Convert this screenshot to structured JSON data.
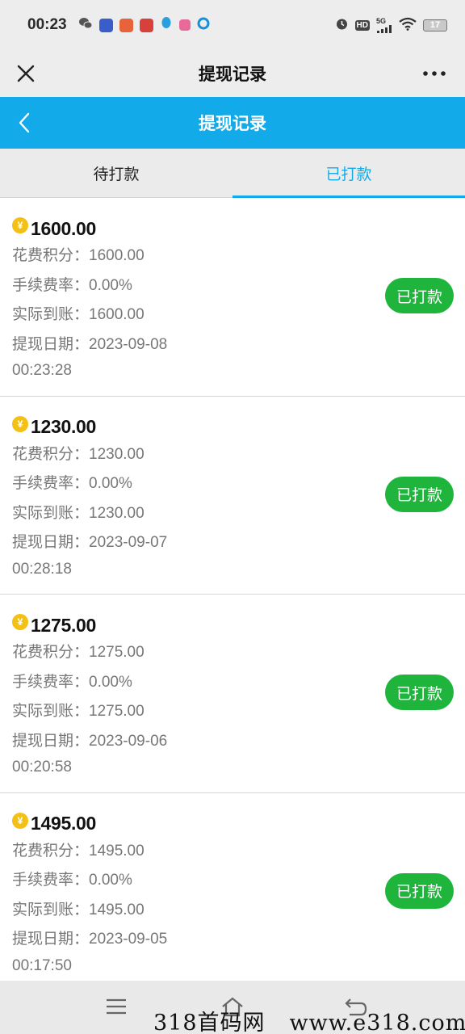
{
  "status_bar": {
    "time": "00:23",
    "network": "5G",
    "hd": "HD",
    "battery": "17"
  },
  "title_bar": {
    "title": "提现记录"
  },
  "app_header": {
    "title": "提现记录"
  },
  "tabs": [
    {
      "label": "待打款",
      "active": false
    },
    {
      "label": "已打款",
      "active": true
    }
  ],
  "labels": {
    "cost": "花费积分：",
    "fee": "手续费率：",
    "actual": "实际到账：",
    "date": "提现日期："
  },
  "records": [
    {
      "amount": "1600.00",
      "cost": "1600.00",
      "fee": "0.00%",
      "actual": "1600.00",
      "date": "2023-09-08",
      "time": "00:23:28",
      "status": "已打款"
    },
    {
      "amount": "1230.00",
      "cost": "1230.00",
      "fee": "0.00%",
      "actual": "1230.00",
      "date": "2023-09-07",
      "time": "00:28:18",
      "status": "已打款"
    },
    {
      "amount": "1275.00",
      "cost": "1275.00",
      "fee": "0.00%",
      "actual": "1275.00",
      "date": "2023-09-06",
      "time": "00:20:58",
      "status": "已打款"
    },
    {
      "amount": "1495.00",
      "cost": "1495.00",
      "fee": "0.00%",
      "actual": "1495.00",
      "date": "2023-09-05",
      "time": "00:17:50",
      "status": "已打款"
    }
  ],
  "currency_symbol": "¥",
  "watermark": {
    "site_name": "318首码网",
    "url": "www.e318.com"
  },
  "colors": {
    "accent": "#12aae8",
    "badge": "#1fb53c",
    "coin": "#f3c015"
  }
}
